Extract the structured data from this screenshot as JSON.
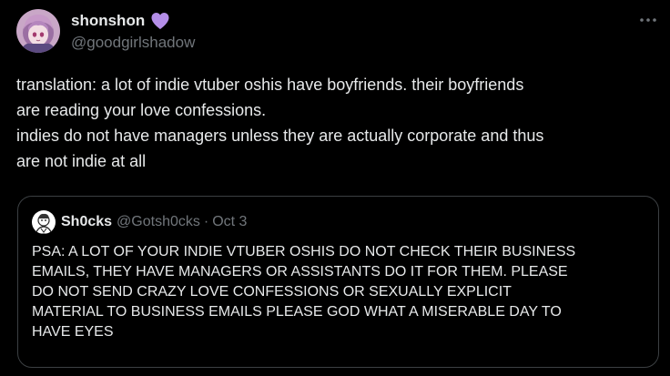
{
  "author": {
    "display_name": "shonshon",
    "handle": "@goodgirlshadow",
    "name_emoji": "purple-heart-icon"
  },
  "more_icon": "more-horizontal-icon",
  "tweet": {
    "lines": [
      "translation: a lot of indie vtuber oshis have boyfriends. their boyfriends",
      "are reading your love confessions.",
      "indies do not have managers unless they are actually corporate and thus",
      "are not indie at all"
    ]
  },
  "quote": {
    "display_name": "Sh0cks",
    "handle": "@Gotsh0cks",
    "separator": "·",
    "date": "Oct 3",
    "lines": [
      "PSA: A LOT OF YOUR INDIE VTUBER OSHIS DO NOT CHECK THEIR BUSINESS",
      "EMAILS, THEY HAVE MANAGERS OR ASSISTANTS DO IT FOR THEM. PLEASE",
      "DO NOT SEND CRAZY LOVE CONFESSIONS OR SEXUALLY EXPLICIT",
      "MATERIAL TO BUSINESS EMAILS PLEASE GOD WHAT A MISERABLE DAY TO",
      "HAVE EYES"
    ]
  },
  "colors": {
    "background": "#000000",
    "text": "#e7e9ea",
    "secondary_text": "#71767b",
    "border": "#3c4043",
    "heart": "#b48ee8"
  }
}
